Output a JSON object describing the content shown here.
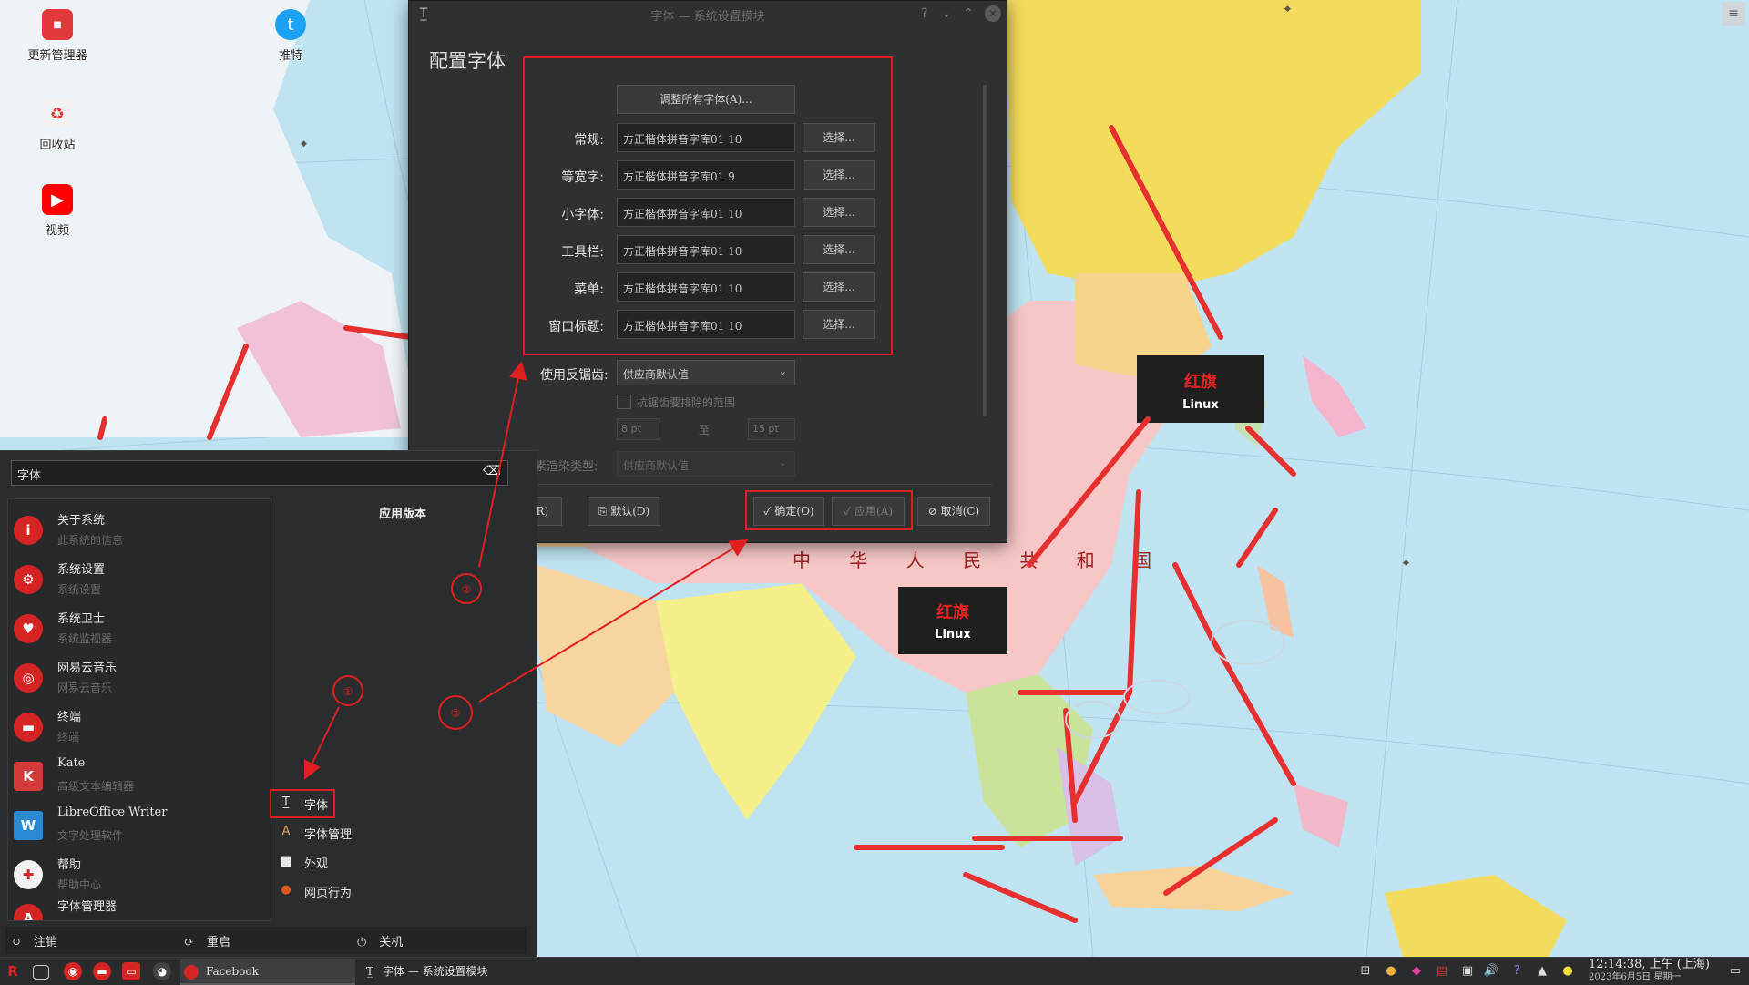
{
  "desktop": {
    "icons": [
      {
        "label": "更新管理器",
        "icon": "update-manager-icon"
      },
      {
        "label": "推特",
        "icon": "twitter-icon"
      },
      {
        "label": "回收站",
        "icon": "trash-icon"
      },
      {
        "label": "视频",
        "icon": "youtube-icon"
      }
    ],
    "map_labels": {
      "country": "中 华 人 民 共 和 国",
      "logo_text": "红旗",
      "logo_sub": "Linux"
    }
  },
  "dialog": {
    "title": "字体 — 系统设置模块",
    "heading": "配置字体",
    "adjust_all": "调整所有字体(A)...",
    "rows": [
      {
        "label": "常规:",
        "value": "方正楷体拼音字库01 10",
        "button": "选择..."
      },
      {
        "label": "等宽字:",
        "value": "方正楷体拼音字库01 9",
        "button": "选择..."
      },
      {
        "label": "小字体:",
        "value": "方正楷体拼音字库01 10",
        "button": "选择..."
      },
      {
        "label": "工具栏:",
        "value": "方正楷体拼音字库01 10",
        "button": "选择..."
      },
      {
        "label": "菜单:",
        "value": "方正楷体拼音字库01 10",
        "button": "选择..."
      },
      {
        "label": "窗口标题:",
        "value": "方正楷体拼音字库01 10",
        "button": "选择..."
      }
    ],
    "antialias_label": "使用反锯齿:",
    "antialias_value": "供应商默认值",
    "exclude_range_label": "抗锯齿要排除的范围",
    "range_from": "8 pt",
    "range_to_label": "至",
    "range_to": "15 pt",
    "subpixel_label": "亚像素渲染类型:",
    "subpixel_value": "供应商默认值",
    "buttons": {
      "reset": "重置(R)",
      "defaults": "默认(D)",
      "ok": "确定(O)",
      "apply": "应用(A)",
      "cancel": "取消(C)"
    }
  },
  "launcher": {
    "search_value": "字体",
    "category_title": "应用版本",
    "apps": [
      {
        "name": "关于系统",
        "desc": "此系统的信息",
        "icon": "info-icon",
        "color": "#d42424"
      },
      {
        "name": "系统设置",
        "desc": "系统设置",
        "icon": "settings-icon",
        "color": "#d42424"
      },
      {
        "name": "系统卫士",
        "desc": "系统监视器",
        "icon": "guard-icon",
        "color": "#d42424"
      },
      {
        "name": "网易云音乐",
        "desc": "网易云音乐",
        "icon": "music-icon",
        "color": "#d42424"
      },
      {
        "name": "终端",
        "desc": "终端",
        "icon": "terminal-icon",
        "color": "#d42424"
      },
      {
        "name": "Kate",
        "desc": "高级文本编辑器",
        "icon": "kate-icon",
        "color": "#d43a3a"
      },
      {
        "name": "LibreOffice Writer",
        "desc": "文字处理软件",
        "icon": "writer-icon",
        "color": "#2a8ad4"
      },
      {
        "name": "帮助",
        "desc": "帮助中心",
        "icon": "help-icon",
        "color": "#d42424"
      },
      {
        "name": "字体管理器",
        "desc": "",
        "icon": "font-manager-icon",
        "color": "#d42424"
      }
    ],
    "sub_items": [
      {
        "name": "字体",
        "icon": "font-icon"
      },
      {
        "name": "字体管理",
        "icon": "font-manager-icon"
      },
      {
        "name": "外观",
        "icon": "folder-icon"
      },
      {
        "name": "网页行为",
        "icon": "web-behavior-icon"
      }
    ],
    "power": {
      "logout": "注销",
      "restart": "重启",
      "shutdown": "关机"
    }
  },
  "taskbar": {
    "tasks": [
      {
        "label": "Facebook"
      },
      {
        "label": "字体 — 系统设置模块"
      }
    ],
    "clock": {
      "time": "12:14:38, 上午 (上海)",
      "date": "2023年6月5日 星期一"
    }
  },
  "annotations": {
    "markers": [
      "①",
      "②",
      "③"
    ]
  },
  "colors": {
    "accent": "#e02020",
    "dialog_bg": "#2f3032",
    "panel_bg": "#2b2c2e"
  }
}
